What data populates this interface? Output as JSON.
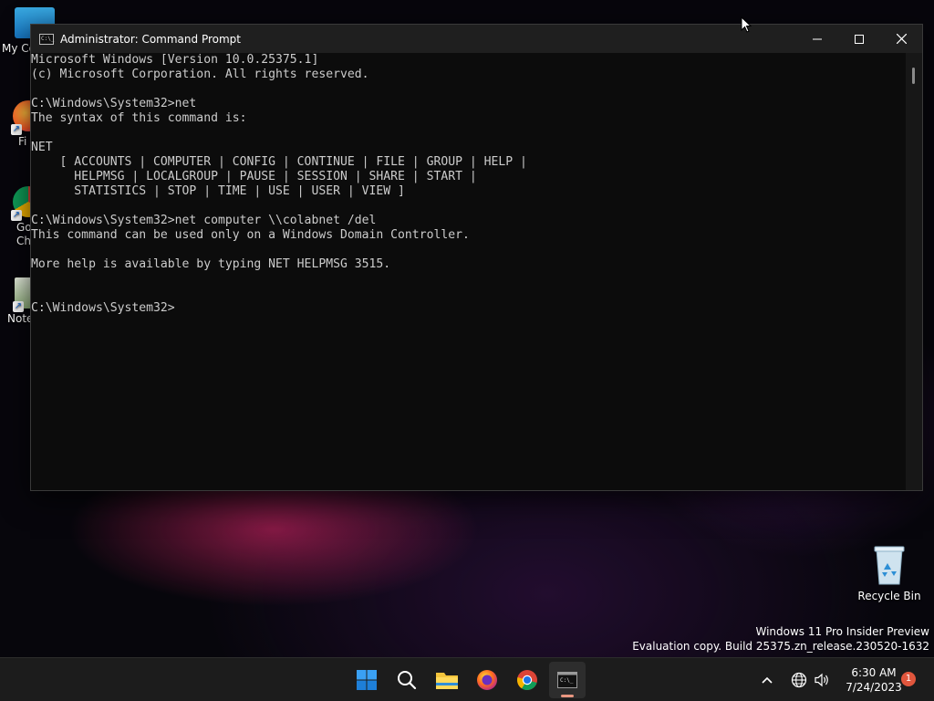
{
  "desktop": {
    "icons": [
      {
        "label": "My Co",
        "icon": "monitor-icon"
      },
      {
        "label": "Fi",
        "icon": "firefox-icon"
      },
      {
        "label": "Go\nChr",
        "icon": "chrome-icon"
      },
      {
        "label": "Note",
        "icon": "notepad-icon"
      }
    ],
    "recycle_bin": {
      "label": "Recycle Bin",
      "icon": "recycle-bin-icon"
    },
    "watermark": {
      "line1": "Windows 11 Pro Insider Preview",
      "line2": "Evaluation copy. Build 25375.zn_release.230520-1632"
    }
  },
  "window": {
    "title": "Administrator: Command Prompt",
    "icon": "cmd-icon",
    "controls": {
      "minimize": "minimize-icon",
      "maximize": "maximize-icon",
      "close": "close-icon"
    },
    "console_text": "Microsoft Windows [Version 10.0.25375.1]\n(c) Microsoft Corporation. All rights reserved.\n\nC:\\Windows\\System32>net\nThe syntax of this command is:\n\nNET\n    [ ACCOUNTS | COMPUTER | CONFIG | CONTINUE | FILE | GROUP | HELP |\n      HELPMSG | LOCALGROUP | PAUSE | SESSION | SHARE | START |\n      STATISTICS | STOP | TIME | USE | USER | VIEW ]\n\nC:\\Windows\\System32>net computer \\\\colabnet /del\nThis command can be used only on a Windows Domain Controller.\n\nMore help is available by typing NET HELPMSG 3515.\n\n\nC:\\Windows\\System32>"
  },
  "taskbar": {
    "apps": [
      {
        "name": "start",
        "icon": "windows-logo-icon"
      },
      {
        "name": "search",
        "icon": "search-icon"
      },
      {
        "name": "file-explorer",
        "icon": "folder-icon"
      },
      {
        "name": "firefox",
        "icon": "firefox-icon"
      },
      {
        "name": "chrome",
        "icon": "chrome-icon"
      },
      {
        "name": "terminal",
        "icon": "terminal-icon",
        "active": true
      }
    ],
    "tray": {
      "chevron": "chevron-up-icon",
      "network": "globe-icon",
      "volume": "speaker-icon"
    },
    "clock": {
      "time": "6:30 AM",
      "date": "7/24/2023"
    },
    "notifications": "1"
  },
  "colors": {
    "accent": "#e0563d",
    "console_bg": "#0c0c0c",
    "console_fg": "#cccccc"
  }
}
